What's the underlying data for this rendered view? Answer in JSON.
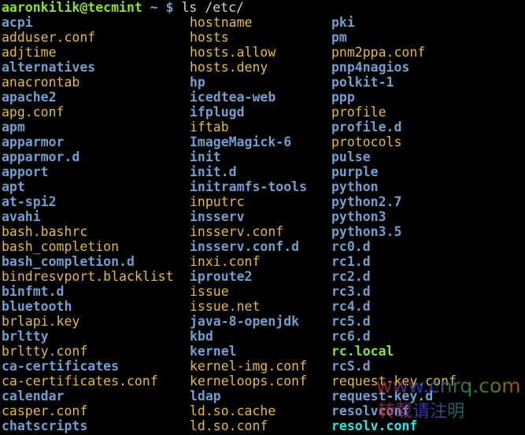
{
  "prompt": {
    "user_host": "aaronkilik@tecmint",
    "path": "~",
    "symbol": "$",
    "command": "ls /etc/"
  },
  "colors": {
    "dir": "#729fcf",
    "file": "#e5b94a",
    "exec": "#8ae234",
    "link": "#34e2e2",
    "background": "#000000"
  },
  "columns": [
    [
      {
        "name": "acpi",
        "type": "dir"
      },
      {
        "name": "adduser.conf",
        "type": "file"
      },
      {
        "name": "adjtime",
        "type": "file"
      },
      {
        "name": "alternatives",
        "type": "dir"
      },
      {
        "name": "anacrontab",
        "type": "file"
      },
      {
        "name": "apache2",
        "type": "dir"
      },
      {
        "name": "apg.conf",
        "type": "file"
      },
      {
        "name": "apm",
        "type": "dir"
      },
      {
        "name": "apparmor",
        "type": "dir"
      },
      {
        "name": "apparmor.d",
        "type": "dir"
      },
      {
        "name": "apport",
        "type": "dir"
      },
      {
        "name": "apt",
        "type": "dir"
      },
      {
        "name": "at-spi2",
        "type": "dir"
      },
      {
        "name": "avahi",
        "type": "dir"
      },
      {
        "name": "bash.bashrc",
        "type": "file"
      },
      {
        "name": "bash_completion",
        "type": "file"
      },
      {
        "name": "bash_completion.d",
        "type": "dir"
      },
      {
        "name": "bindresvport.blacklist",
        "type": "file"
      },
      {
        "name": "binfmt.d",
        "type": "dir"
      },
      {
        "name": "bluetooth",
        "type": "dir"
      },
      {
        "name": "brlapi.key",
        "type": "file"
      },
      {
        "name": "brltty",
        "type": "dir"
      },
      {
        "name": "brltty.conf",
        "type": "file"
      },
      {
        "name": "ca-certificates",
        "type": "dir"
      },
      {
        "name": "ca-certificates.conf",
        "type": "file"
      },
      {
        "name": "calendar",
        "type": "dir"
      },
      {
        "name": "casper.conf",
        "type": "file"
      },
      {
        "name": "chatscripts",
        "type": "dir"
      }
    ],
    [
      {
        "name": "hostname",
        "type": "file"
      },
      {
        "name": "hosts",
        "type": "file"
      },
      {
        "name": "hosts.allow",
        "type": "file"
      },
      {
        "name": "hosts.deny",
        "type": "file"
      },
      {
        "name": "hp",
        "type": "dir"
      },
      {
        "name": "icedtea-web",
        "type": "dir"
      },
      {
        "name": "ifplugd",
        "type": "dir"
      },
      {
        "name": "iftab",
        "type": "file"
      },
      {
        "name": "ImageMagick-6",
        "type": "dir"
      },
      {
        "name": "init",
        "type": "dir"
      },
      {
        "name": "init.d",
        "type": "dir"
      },
      {
        "name": "initramfs-tools",
        "type": "dir"
      },
      {
        "name": "inputrc",
        "type": "file"
      },
      {
        "name": "insserv",
        "type": "dir"
      },
      {
        "name": "insserv.conf",
        "type": "file"
      },
      {
        "name": "insserv.conf.d",
        "type": "dir"
      },
      {
        "name": "inxi.conf",
        "type": "file"
      },
      {
        "name": "iproute2",
        "type": "dir"
      },
      {
        "name": "issue",
        "type": "file"
      },
      {
        "name": "issue.net",
        "type": "file"
      },
      {
        "name": "java-8-openjdk",
        "type": "dir"
      },
      {
        "name": "kbd",
        "type": "dir"
      },
      {
        "name": "kernel",
        "type": "dir"
      },
      {
        "name": "kernel-img.conf",
        "type": "file"
      },
      {
        "name": "kerneloops.conf",
        "type": "file"
      },
      {
        "name": "ldap",
        "type": "dir"
      },
      {
        "name": "ld.so.cache",
        "type": "file"
      },
      {
        "name": "ld.so.conf",
        "type": "file"
      }
    ],
    [
      {
        "name": "pki",
        "type": "dir"
      },
      {
        "name": "pm",
        "type": "dir"
      },
      {
        "name": "pnm2ppa.conf",
        "type": "file"
      },
      {
        "name": "pnp4nagios",
        "type": "dir"
      },
      {
        "name": "polkit-1",
        "type": "dir"
      },
      {
        "name": "ppp",
        "type": "dir"
      },
      {
        "name": "profile",
        "type": "file"
      },
      {
        "name": "profile.d",
        "type": "dir"
      },
      {
        "name": "protocols",
        "type": "file"
      },
      {
        "name": "pulse",
        "type": "dir"
      },
      {
        "name": "purple",
        "type": "dir"
      },
      {
        "name": "python",
        "type": "dir"
      },
      {
        "name": "python2.7",
        "type": "dir"
      },
      {
        "name": "python3",
        "type": "dir"
      },
      {
        "name": "python3.5",
        "type": "dir"
      },
      {
        "name": "rc0.d",
        "type": "dir"
      },
      {
        "name": "rc1.d",
        "type": "dir"
      },
      {
        "name": "rc2.d",
        "type": "dir"
      },
      {
        "name": "rc3.d",
        "type": "dir"
      },
      {
        "name": "rc4.d",
        "type": "dir"
      },
      {
        "name": "rc5.d",
        "type": "dir"
      },
      {
        "name": "rc6.d",
        "type": "dir"
      },
      {
        "name": "rc.local",
        "type": "exec"
      },
      {
        "name": "rcS.d",
        "type": "dir"
      },
      {
        "name": "request-key.conf",
        "type": "file"
      },
      {
        "name": "request-key.d",
        "type": "dir"
      },
      {
        "name": "resolvconf",
        "type": "dir"
      },
      {
        "name": "resolv.conf",
        "type": "link"
      }
    ]
  ],
  "watermark": {
    "line1": "www.cnrq.com",
    "line2": "转载请注明"
  }
}
